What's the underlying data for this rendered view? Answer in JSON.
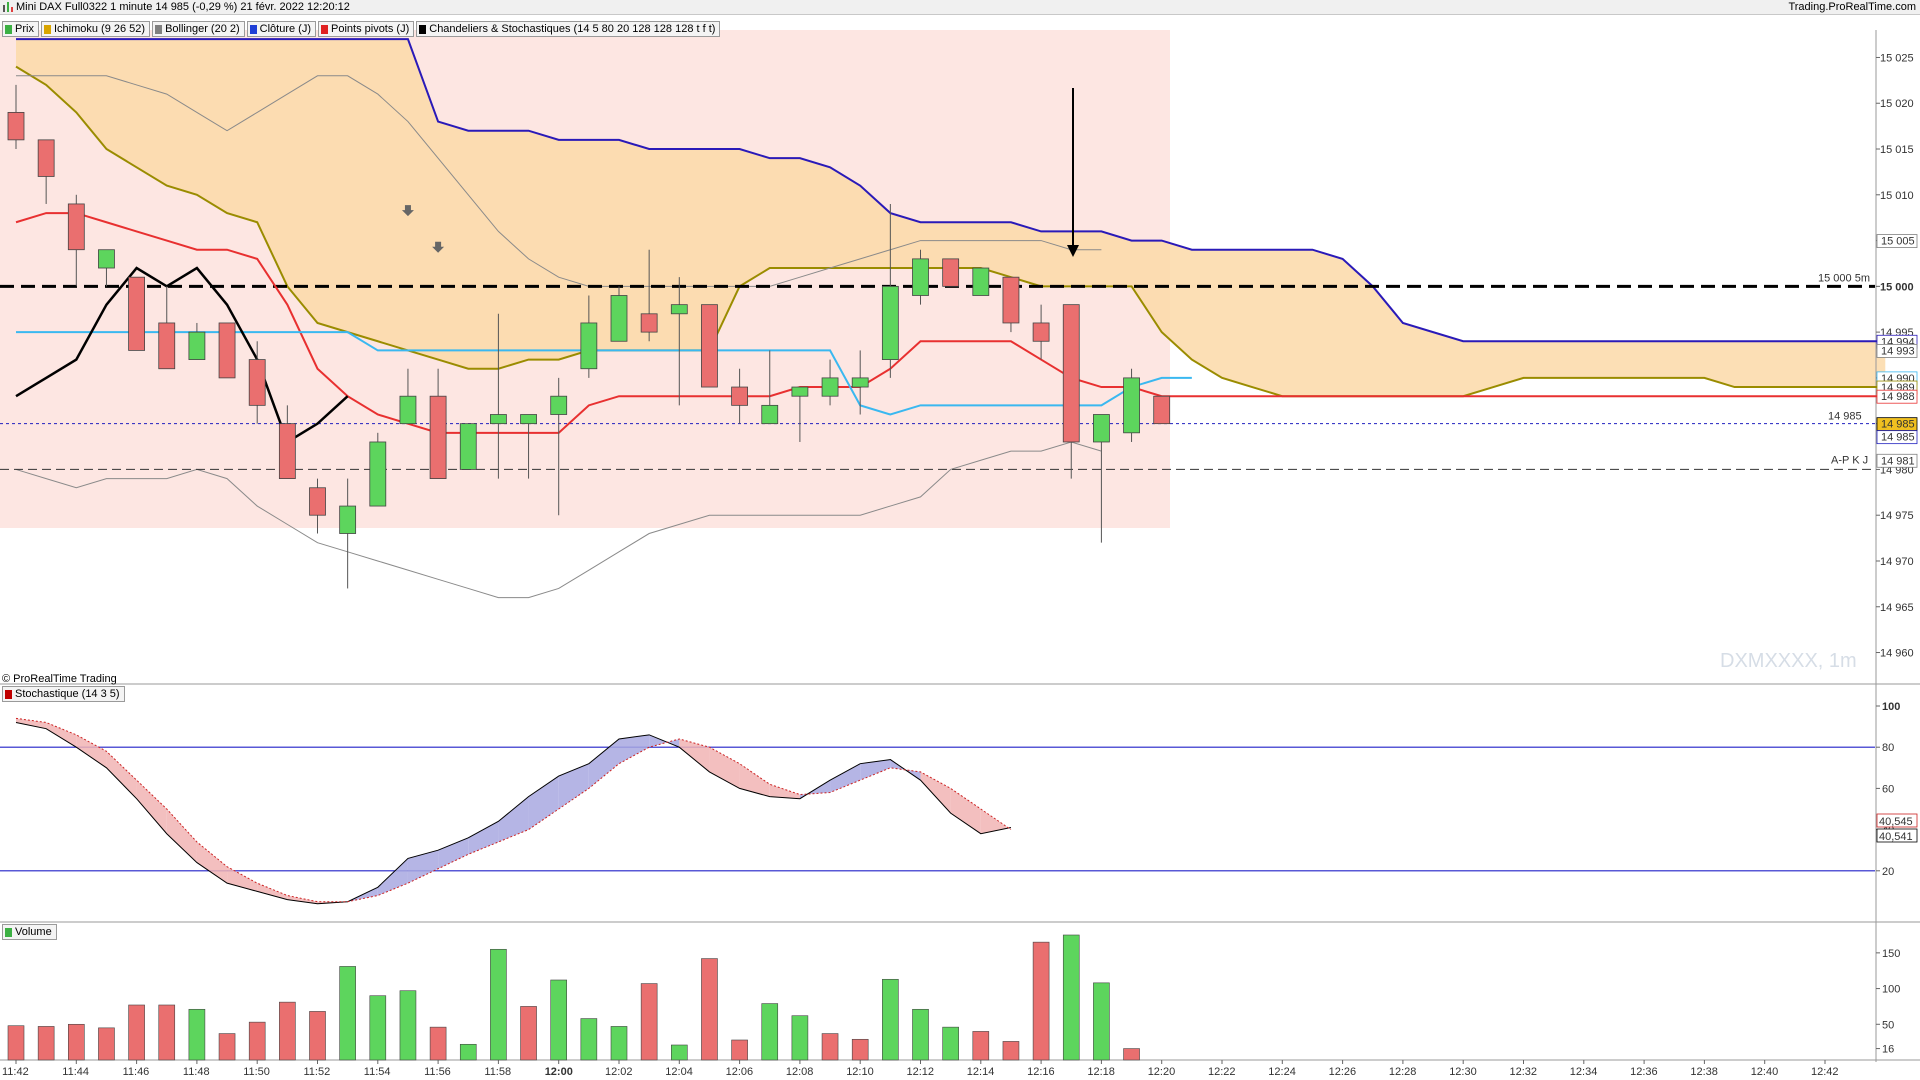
{
  "header": {
    "title": "Mini DAX Full0322 1 minute 14 985 (-0,29 %) 21 févr. 2022 12:20:12",
    "site": "Trading.ProRealTime.com"
  },
  "price_panel": {
    "indicators": [
      {
        "label": "Prix",
        "color": "#3cb043"
      },
      {
        "label": "Ichimoku (9 26 52)",
        "color": "#d9a400"
      },
      {
        "label": "Bollinger (20 2)",
        "color": "#808080"
      },
      {
        "label": "Clôture (J)",
        "color": "#1f3fd6"
      },
      {
        "label": "Points pivots (J)",
        "color": "#e02020"
      },
      {
        "label": "Chandeliers & Stochastiques (14 5 80 20 128 128 128 t f t)",
        "color": "#000000"
      }
    ],
    "watermark": "DXMXXXX, 1m",
    "credit": "© ProRealTime Trading",
    "level_15000_label": "15 000 5m",
    "current_level_label": "14 985",
    "apkj_label": "A-P K J"
  },
  "stochastic_panel": {
    "label": "Stochastique (14 3 5)",
    "color": "#c00000"
  },
  "volume_panel": {
    "label": "Volume",
    "color": "#3cb043"
  },
  "chart_data": [
    {
      "type": "candlestick",
      "title": "Mini DAX Full0322 1 minute",
      "ylim": [
        14957,
        15028
      ],
      "yticks": [
        14960,
        14965,
        14970,
        14975,
        14980,
        14985,
        14990,
        14995,
        15000,
        15005,
        15010,
        15015,
        15020,
        15025
      ],
      "ytick_labels": [
        "14 960",
        "14 965",
        "14 970",
        "14 975",
        "14 980",
        "14 985",
        "14 990",
        "14 995",
        "15 000",
        "15 005",
        "15 010",
        "15 015",
        "15 020",
        "15 025"
      ],
      "x_time_labels": [
        "11:42",
        "11:44",
        "11:46",
        "11:48",
        "11:50",
        "11:52",
        "11:54",
        "11:56",
        "11:58",
        "12:00",
        "12:02",
        "12:04",
        "12:06",
        "12:08",
        "12:10",
        "12:12",
        "12:14",
        "12:16",
        "12:18",
        "12:20",
        "12:22",
        "12:24",
        "12:26",
        "12:28",
        "12:30",
        "12:32",
        "12:34",
        "12:36",
        "12:38",
        "12:40",
        "12:42"
      ],
      "candles": [
        {
          "t": "11:42",
          "o": 15019,
          "h": 15022,
          "l": 15015,
          "c": 15016
        },
        {
          "t": "11:43",
          "o": 15016,
          "h": 15016,
          "l": 15009,
          "c": 15012
        },
        {
          "t": "11:44",
          "o": 15009,
          "h": 15010,
          "l": 15000,
          "c": 15004
        },
        {
          "t": "11:45",
          "o": 15002,
          "h": 15004,
          "l": 15000,
          "c": 15004
        },
        {
          "t": "11:46",
          "o": 15001,
          "h": 15001,
          "l": 14993,
          "c": 14993
        },
        {
          "t": "11:47",
          "o": 14996,
          "h": 15000,
          "l": 14991,
          "c": 14991
        },
        {
          "t": "11:48",
          "o": 14992,
          "h": 14996,
          "l": 14992,
          "c": 14995
        },
        {
          "t": "11:49",
          "o": 14996,
          "h": 14996,
          "l": 14990,
          "c": 14990
        },
        {
          "t": "11:50",
          "o": 14992,
          "h": 14994,
          "l": 14985,
          "c": 14987
        },
        {
          "t": "11:51",
          "o": 14985,
          "h": 14987,
          "l": 14979,
          "c": 14979
        },
        {
          "t": "11:52",
          "o": 14978,
          "h": 14979,
          "l": 14973,
          "c": 14975
        },
        {
          "t": "11:53",
          "o": 14973,
          "h": 14979,
          "l": 14967,
          "c": 14976
        },
        {
          "t": "11:54",
          "o": 14976,
          "h": 14984,
          "l": 14976,
          "c": 14983
        },
        {
          "t": "11:55",
          "o": 14985,
          "h": 14991,
          "l": 14985,
          "c": 14988
        },
        {
          "t": "11:56",
          "o": 14988,
          "h": 14991,
          "l": 14979,
          "c": 14979
        },
        {
          "t": "11:57",
          "o": 14980,
          "h": 14985,
          "l": 14980,
          "c": 14985
        },
        {
          "t": "11:58",
          "o": 14985,
          "h": 14997,
          "l": 14979,
          "c": 14986
        },
        {
          "t": "11:59",
          "o": 14985,
          "h": 14985,
          "l": 14979,
          "c": 14986
        },
        {
          "t": "12:00",
          "o": 14986,
          "h": 14990,
          "l": 14975,
          "c": 14988
        },
        {
          "t": "12:01",
          "o": 14991,
          "h": 14999,
          "l": 14990,
          "c": 14996
        },
        {
          "t": "12:02",
          "o": 14994,
          "h": 15000,
          "l": 14994,
          "c": 14999
        },
        {
          "t": "12:03",
          "o": 14997,
          "h": 15004,
          "l": 14994,
          "c": 14995
        },
        {
          "t": "12:04",
          "o": 14997,
          "h": 15001,
          "l": 14987,
          "c": 14998
        },
        {
          "t": "12:05",
          "o": 14998,
          "h": 14998,
          "l": 14989,
          "c": 14989
        },
        {
          "t": "12:06",
          "o": 14989,
          "h": 14991,
          "l": 14985,
          "c": 14987
        },
        {
          "t": "12:07",
          "o": 14985,
          "h": 14993,
          "l": 14985,
          "c": 14987
        },
        {
          "t": "12:08",
          "o": 14988,
          "h": 14989,
          "l": 14983,
          "c": 14989
        },
        {
          "t": "12:09",
          "o": 14988,
          "h": 14992,
          "l": 14987,
          "c": 14990
        },
        {
          "t": "12:10",
          "o": 14989,
          "h": 14993,
          "l": 14986,
          "c": 14990
        },
        {
          "t": "12:11",
          "o": 14992,
          "h": 15009,
          "l": 14990,
          "c": 15000
        },
        {
          "t": "12:12",
          "o": 14999,
          "h": 15004,
          "l": 14998,
          "c": 15003
        },
        {
          "t": "12:13",
          "o": 15003,
          "h": 15003,
          "l": 15000,
          "c": 15000
        },
        {
          "t": "12:14",
          "o": 14999,
          "h": 15002,
          "l": 14999,
          "c": 15002
        },
        {
          "t": "12:15",
          "o": 15001,
          "h": 15001,
          "l": 14995,
          "c": 14996
        },
        {
          "t": "12:16",
          "o": 14996,
          "h": 14998,
          "l": 14992,
          "c": 14994
        },
        {
          "t": "12:17",
          "o": 14998,
          "h": 14998,
          "l": 14979,
          "c": 14983
        },
        {
          "t": "12:18",
          "o": 14983,
          "h": 14986,
          "l": 14972,
          "c": 14986
        },
        {
          "t": "12:19",
          "o": 14984,
          "h": 14991,
          "l": 14983,
          "c": 14990
        },
        {
          "t": "12:20",
          "o": 14988,
          "h": 14988,
          "l": 14985,
          "c": 14985
        }
      ],
      "series": [
        {
          "name": "Kumo span A",
          "color": "#9a8c00",
          "values": [
            15024,
            15022,
            15019,
            15015,
            15013,
            15011,
            15010,
            15008,
            15007,
            15000,
            14996,
            14995,
            14994,
            14993,
            14992,
            14991,
            14991,
            14992,
            14992,
            14993,
            14993,
            14993,
            14993,
            14993,
            15000,
            15002,
            15002,
            15002,
            15002,
            15002,
            15002,
            15002,
            15002,
            15001,
            15000,
            15000,
            15000,
            15000,
            14995,
            14992,
            14990,
            14989,
            14988,
            14988,
            14988,
            14988,
            14988,
            14988,
            14988,
            14989,
            14990,
            14990,
            14990,
            14990,
            14990,
            14990,
            14990,
            14989,
            14989,
            14989,
            14989,
            14989,
            14989
          ]
        },
        {
          "name": "Kumo span B",
          "color": "#2a1ab8",
          "values": [
            15040,
            15040,
            15040,
            15040,
            15040,
            15040,
            15040,
            15040,
            15040,
            15040,
            15040,
            15040,
            15040,
            15040,
            15018,
            15017,
            15017,
            15017,
            15016,
            15016,
            15016,
            15015,
            15015,
            15015,
            15015,
            15014,
            15014,
            15013,
            15011,
            15008,
            15007,
            15007,
            15007,
            15007,
            15006,
            15006,
            15006,
            15005,
            15005,
            15004,
            15004,
            15004,
            15004,
            15004,
            15003,
            15000,
            14996,
            14995,
            14994,
            14994,
            14994,
            14994,
            14994,
            14994,
            14994,
            14994,
            14994,
            14994,
            14994,
            14994,
            14994,
            14994,
            14994
          ]
        },
        {
          "name": "Tenkan",
          "color": "#e83030",
          "values": [
            15007,
            15008,
            15008,
            15007,
            15006,
            15005,
            15004,
            15004,
            15003,
            14998,
            14991,
            14988,
            14986,
            14985,
            14984,
            14984,
            14984,
            14984,
            14984,
            14987,
            14988,
            14988,
            14988,
            14988,
            14988,
            14988,
            14989,
            14989,
            14989,
            14991,
            14994,
            14994,
            14994,
            14994,
            14992,
            14990,
            14989,
            14989,
            14988,
            14988,
            14988,
            14988,
            14988,
            14988,
            14988,
            14988,
            14988,
            14988,
            14988,
            14988,
            14988,
            14988,
            14988,
            14988,
            14988,
            14988,
            14988,
            14988,
            14988,
            14988,
            14988,
            14988,
            14988
          ]
        },
        {
          "name": "Kijun",
          "color": "#3ab8f0",
          "values": [
            14995,
            14995,
            14995,
            14995,
            14995,
            14995,
            14995,
            14995,
            14995,
            14995,
            14995,
            14995,
            14993,
            14993,
            14993,
            14993,
            14993,
            14993,
            14993,
            14993,
            14993,
            14993,
            14993,
            14993,
            14993,
            14993,
            14993,
            14993,
            14987,
            14986,
            14987,
            14987,
            14987,
            14987,
            14987,
            14987,
            14987,
            14989,
            14990,
            14990
          ]
        },
        {
          "name": "Chikou",
          "color": "#000000",
          "values": [
            14988,
            14990,
            14992,
            14998,
            15002,
            15000,
            15002,
            14998,
            14992,
            14983,
            14985,
            14988
          ]
        },
        {
          "name": "Bollinger",
          "color": "#8a8a8a",
          "values": [
            15022,
            15023,
            15023,
            15023,
            15022,
            15021,
            15019,
            15018,
            15014,
            15011,
            15008,
            15005,
            15004
          ]
        }
      ],
      "levels": [
        {
          "name": "15 000 5m",
          "value": 15000,
          "color": "#000000",
          "style": "dashed"
        },
        {
          "name": "A-P K J",
          "value": 14980,
          "color": "#333333",
          "style": "dashed"
        },
        {
          "name": "14 985",
          "value": 14985,
          "color": "#2020c0",
          "style": "dotted"
        }
      ],
      "price_tags": [
        {
          "label": "15 005",
          "value": 15005,
          "color": "#808080"
        },
        {
          "label": "14 994",
          "value": 14994,
          "color": "#2a1ab8"
        },
        {
          "label": "14 993",
          "value": 14993,
          "color": "#808080"
        },
        {
          "label": "14 990",
          "value": 14990,
          "color": "#3ab8f0"
        },
        {
          "label": "14 989",
          "value": 14989,
          "color": "#9a8c00"
        },
        {
          "label": "14 988",
          "value": 14988,
          "color": "#e83030"
        },
        {
          "label": "14 985",
          "value": 14985,
          "color": "#000000",
          "fill": "#f0c020"
        },
        {
          "label": "14 985",
          "value": 14985,
          "color": "#2020c0"
        },
        {
          "label": "14 981",
          "value": 14981,
          "color": "#808080"
        }
      ]
    },
    {
      "type": "area",
      "title": "Stochastique (14 3 5)",
      "ylim": [
        0,
        100
      ],
      "yticks": [
        20,
        40,
        60,
        80,
        100
      ],
      "ytick_labels": [
        "20",
        "40",
        "60",
        "80",
        "100"
      ],
      "series": [
        {
          "name": "%K",
          "color": "#000000",
          "values": [
            92,
            89,
            80,
            70,
            55,
            38,
            24,
            14,
            10,
            6,
            4,
            5,
            12,
            26,
            30,
            36,
            44,
            56,
            66,
            72,
            84,
            86,
            80,
            68,
            60,
            56,
            55,
            64,
            72,
            74,
            64,
            48,
            38,
            41
          ]
        },
        {
          "name": "%D",
          "color": "#cc2222",
          "values": [
            94,
            92,
            86,
            78,
            64,
            50,
            34,
            22,
            14,
            8,
            5,
            5,
            8,
            14,
            21,
            28,
            34,
            40,
            50,
            60,
            72,
            80,
            84,
            80,
            72,
            62,
            57,
            58,
            64,
            70,
            68,
            60,
            50,
            40
          ]
        }
      ],
      "levels": [
        80,
        20
      ],
      "last_values": {
        "k": "40,541",
        "d": "40,545"
      }
    },
    {
      "type": "bar",
      "title": "Volume",
      "ylim": [
        0,
        175
      ],
      "yticks": [
        16,
        50,
        100,
        150
      ],
      "ytick_labels": [
        "16",
        "50",
        "100",
        "150"
      ],
      "values": [
        48,
        47,
        50,
        45,
        77,
        77,
        71,
        37,
        53,
        81,
        68,
        131,
        90,
        97,
        46,
        22,
        155,
        75,
        112,
        58,
        47,
        107,
        21,
        142,
        28,
        79,
        62,
        37,
        29,
        113,
        71,
        46,
        40,
        26,
        165,
        175,
        108,
        16
      ],
      "colors": [
        "r",
        "r",
        "r",
        "r",
        "r",
        "r",
        "g",
        "r",
        "r",
        "r",
        "r",
        "g",
        "g",
        "g",
        "r",
        "g",
        "g",
        "r",
        "g",
        "g",
        "g",
        "r",
        "g",
        "r",
        "r",
        "g",
        "g",
        "r",
        "r",
        "g",
        "g",
        "g",
        "r",
        "r",
        "r",
        "g",
        "g",
        "r"
      ]
    }
  ]
}
